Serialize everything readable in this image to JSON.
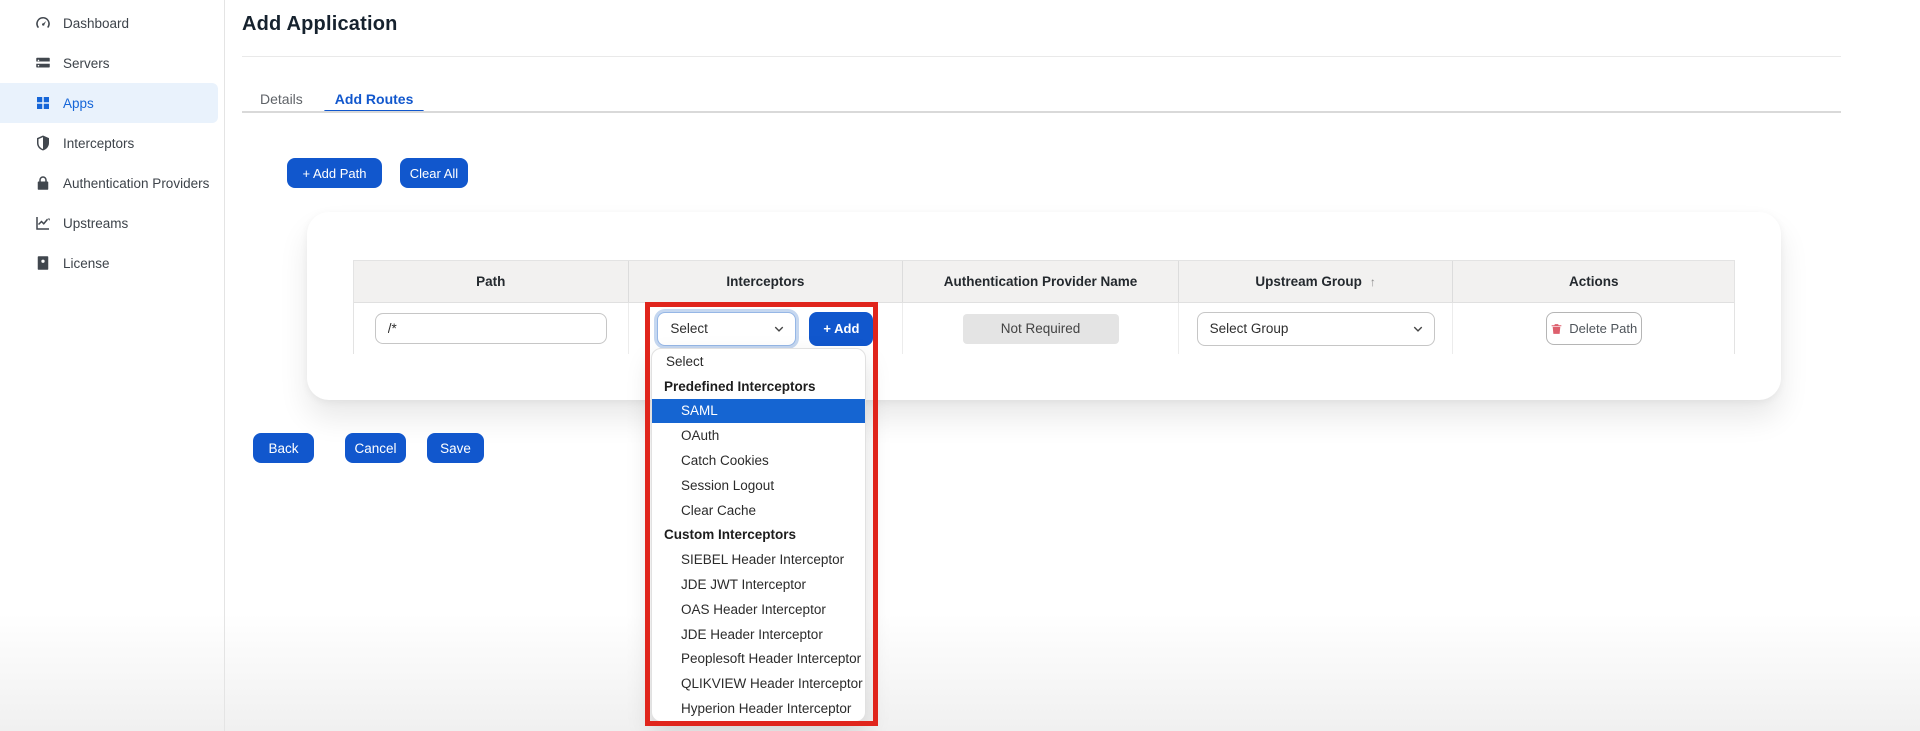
{
  "colors": {
    "primary": "#1157cd",
    "annotation": "#e0251c",
    "highlight": "#1565d2",
    "sidebar-active-bg": "#e9f2fc",
    "sidebar-active-text": "#1666d8",
    "table-header-bg": "#f2f1f0",
    "badge-bg": "#e4e4e4",
    "danger": "#dd5f6d"
  },
  "sidebar": {
    "items": [
      {
        "label": "Dashboard",
        "icon": "dashboard-icon",
        "active": false
      },
      {
        "label": "Servers",
        "icon": "servers-icon",
        "active": false
      },
      {
        "label": "Apps",
        "icon": "apps-icon",
        "active": true
      },
      {
        "label": "Interceptors",
        "icon": "shield-icon",
        "active": false
      },
      {
        "label": "Authentication Providers",
        "icon": "lock-icon",
        "active": false
      },
      {
        "label": "Upstreams",
        "icon": "chart-icon",
        "active": false
      },
      {
        "label": "License",
        "icon": "license-icon",
        "active": false
      }
    ]
  },
  "header": {
    "title": "Add Application"
  },
  "tabs": [
    {
      "label": "Details",
      "active": false
    },
    {
      "label": "Add Routes",
      "active": true
    }
  ],
  "toolbar": {
    "add_path_label": "+ Add Path",
    "clear_all_label": "Clear All"
  },
  "routes_table": {
    "columns": [
      "Path",
      "Interceptors",
      "Authentication Provider Name",
      "Upstream Group",
      "Actions"
    ],
    "sort": {
      "column": "Upstream Group",
      "direction": "asc",
      "icon": "↑"
    },
    "row": {
      "path_value": "/*",
      "interceptor_select_value": "Select",
      "add_button_label": "+ Add",
      "auth_provider_value": "Not Required",
      "upstream_select_value": "Select Group",
      "delete_label": "Delete Path"
    }
  },
  "interceptor_dropdown": {
    "items": [
      {
        "label": "Select",
        "type": "option",
        "selected": false
      },
      {
        "label": "Predefined Interceptors",
        "type": "group"
      },
      {
        "label": "SAML",
        "type": "option",
        "selected": true
      },
      {
        "label": "OAuth",
        "type": "option",
        "selected": false
      },
      {
        "label": "Catch Cookies",
        "type": "option",
        "selected": false
      },
      {
        "label": "Session Logout",
        "type": "option",
        "selected": false
      },
      {
        "label": "Clear Cache",
        "type": "option",
        "selected": false
      },
      {
        "label": "Custom Interceptors",
        "type": "group"
      },
      {
        "label": "SIEBEL Header Interceptor",
        "type": "option",
        "selected": false
      },
      {
        "label": "JDE JWT Interceptor",
        "type": "option",
        "selected": false
      },
      {
        "label": "OAS Header Interceptor",
        "type": "option",
        "selected": false
      },
      {
        "label": "JDE Header Interceptor",
        "type": "option",
        "selected": false
      },
      {
        "label": "Peoplesoft Header Interceptor",
        "type": "option",
        "selected": false
      },
      {
        "label": "QLIKVIEW Header Interceptor",
        "type": "option",
        "selected": false
      },
      {
        "label": "Hyperion Header Interceptor",
        "type": "option",
        "selected": false
      }
    ]
  },
  "footer": {
    "back_label": "Back",
    "cancel_label": "Cancel",
    "save_label": "Save"
  }
}
